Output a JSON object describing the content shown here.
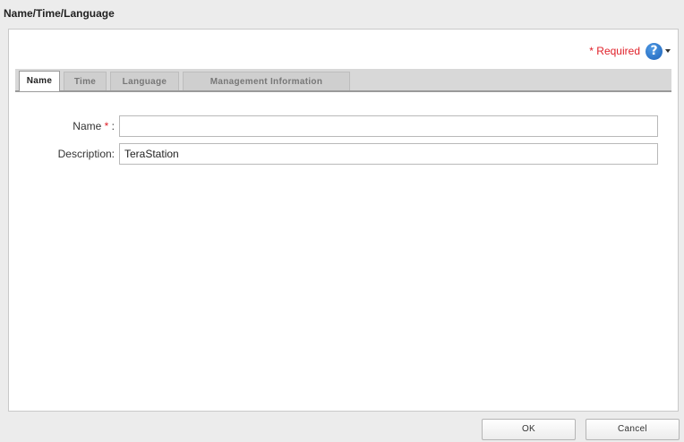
{
  "window": {
    "title": "Name/Time/Language"
  },
  "header": {
    "required_star": "*",
    "required_label": "Required",
    "help_glyph": "?",
    "help_icon": "help-icon"
  },
  "tabs": [
    {
      "label": "Name",
      "active": true
    },
    {
      "label": "Time",
      "active": false
    },
    {
      "label": "Language",
      "active": false
    },
    {
      "label": "Management Information",
      "active": false
    }
  ],
  "form": {
    "name_label": "Name",
    "name_required_star": "*",
    "name_colon": ":",
    "name_value": "",
    "description_label": "Description:",
    "description_value": "TeraStation"
  },
  "footer": {
    "ok_label": "OK",
    "cancel_label": "Cancel"
  },
  "colors": {
    "required_red": "#e0212a",
    "help_blue": "#1d62b8",
    "panel_bg": "#ffffff",
    "chrome_bg": "#ececec"
  }
}
